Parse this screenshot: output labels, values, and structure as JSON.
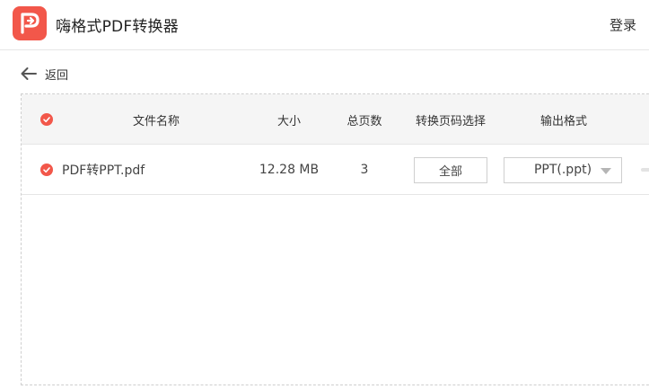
{
  "app": {
    "title": "嗨格式PDF转换器",
    "login_label": "登录"
  },
  "nav": {
    "back_label": "返回"
  },
  "table": {
    "headers": {
      "name": "文件名称",
      "size": "大小",
      "pages": "总页数",
      "page_select": "转换页码选择",
      "output_format": "输出格式"
    },
    "rows": [
      {
        "checked": true,
        "name": "PDF转PPT.pdf",
        "size": "12.28 MB",
        "pages": "3",
        "page_select": "全部",
        "output_format": "PPT(.ppt)"
      }
    ]
  },
  "colors": {
    "accent": "#f2574a",
    "header_bg": "#f5f5f5",
    "border": "#cfcfcf"
  },
  "icons": {
    "logo": "app-logo-icon",
    "back": "arrow-left-icon",
    "check": "check-circle-icon",
    "caret": "caret-down-icon"
  }
}
